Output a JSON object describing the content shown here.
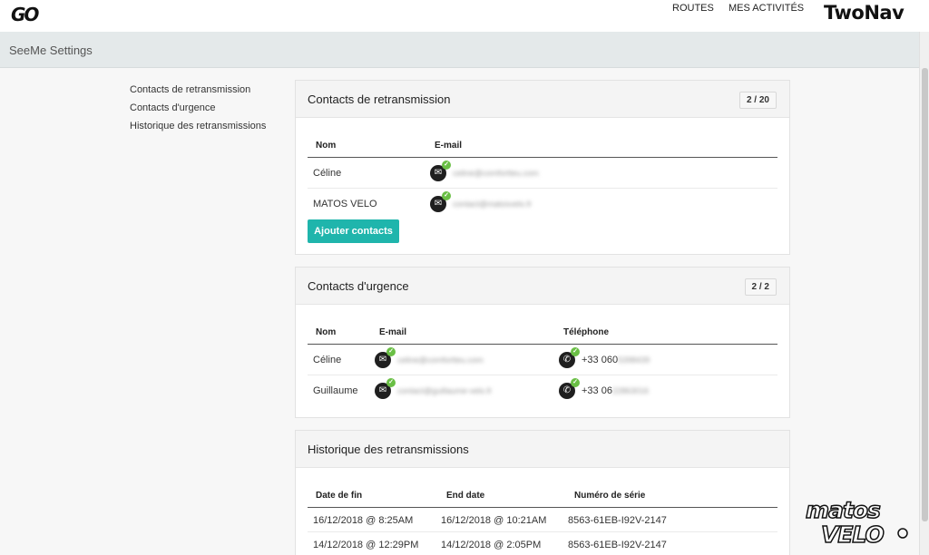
{
  "header": {
    "logo_text": "GO",
    "nav": [
      "ROUTES",
      "MES ACTIVITÉS"
    ],
    "brand": "TwoNav"
  },
  "settings": {
    "title": "SeeMe Settings"
  },
  "sidenav": [
    "Contacts de retransmission",
    "Contacts d'urgence",
    "Historique des retransmissions"
  ],
  "retransmission": {
    "title": "Contacts de retransmission",
    "count": "2 / 20",
    "columns": [
      "Nom",
      "E-mail"
    ],
    "rows": [
      {
        "name": "Céline",
        "email": "celine@comfortteu.com"
      },
      {
        "name": "MATOS VELO",
        "email": "contact@matosvelo.fr"
      }
    ],
    "add_button": "Ajouter contacts"
  },
  "emergency": {
    "title": "Contacts d'urgence",
    "count": "2 / 2",
    "columns": [
      "Nom",
      "E-mail",
      "Téléphone"
    ],
    "rows": [
      {
        "name": "Céline",
        "email": "celine@comfortteu.com",
        "phone_prefix": "+33 060",
        "phone_hidden": "5398439"
      },
      {
        "name": "Guillaume",
        "email": "contact@guillaume-velo.fr",
        "phone_prefix": "+33 06",
        "phone_hidden": "22863016"
      }
    ]
  },
  "history": {
    "title": "Historique des retransmissions",
    "columns": [
      "Date de fin",
      "End date",
      "Numéro de série"
    ],
    "rows": [
      {
        "date_fin": "16/12/2018 @ 8:25AM",
        "end_date": "16/12/2018 @ 10:21AM",
        "serial": "8563-61EB-I92V-2147"
      },
      {
        "date_fin": "14/12/2018 @ 12:29PM",
        "end_date": "14/12/2018 @ 2:05PM",
        "serial": "8563-61EB-I92V-2147"
      }
    ]
  },
  "watermark": {
    "line1": "matos",
    "line2": "VELO"
  },
  "colors": {
    "accent": "#1fb5ac",
    "check": "#6abf45",
    "settings_bar": "#e4e9ea"
  }
}
